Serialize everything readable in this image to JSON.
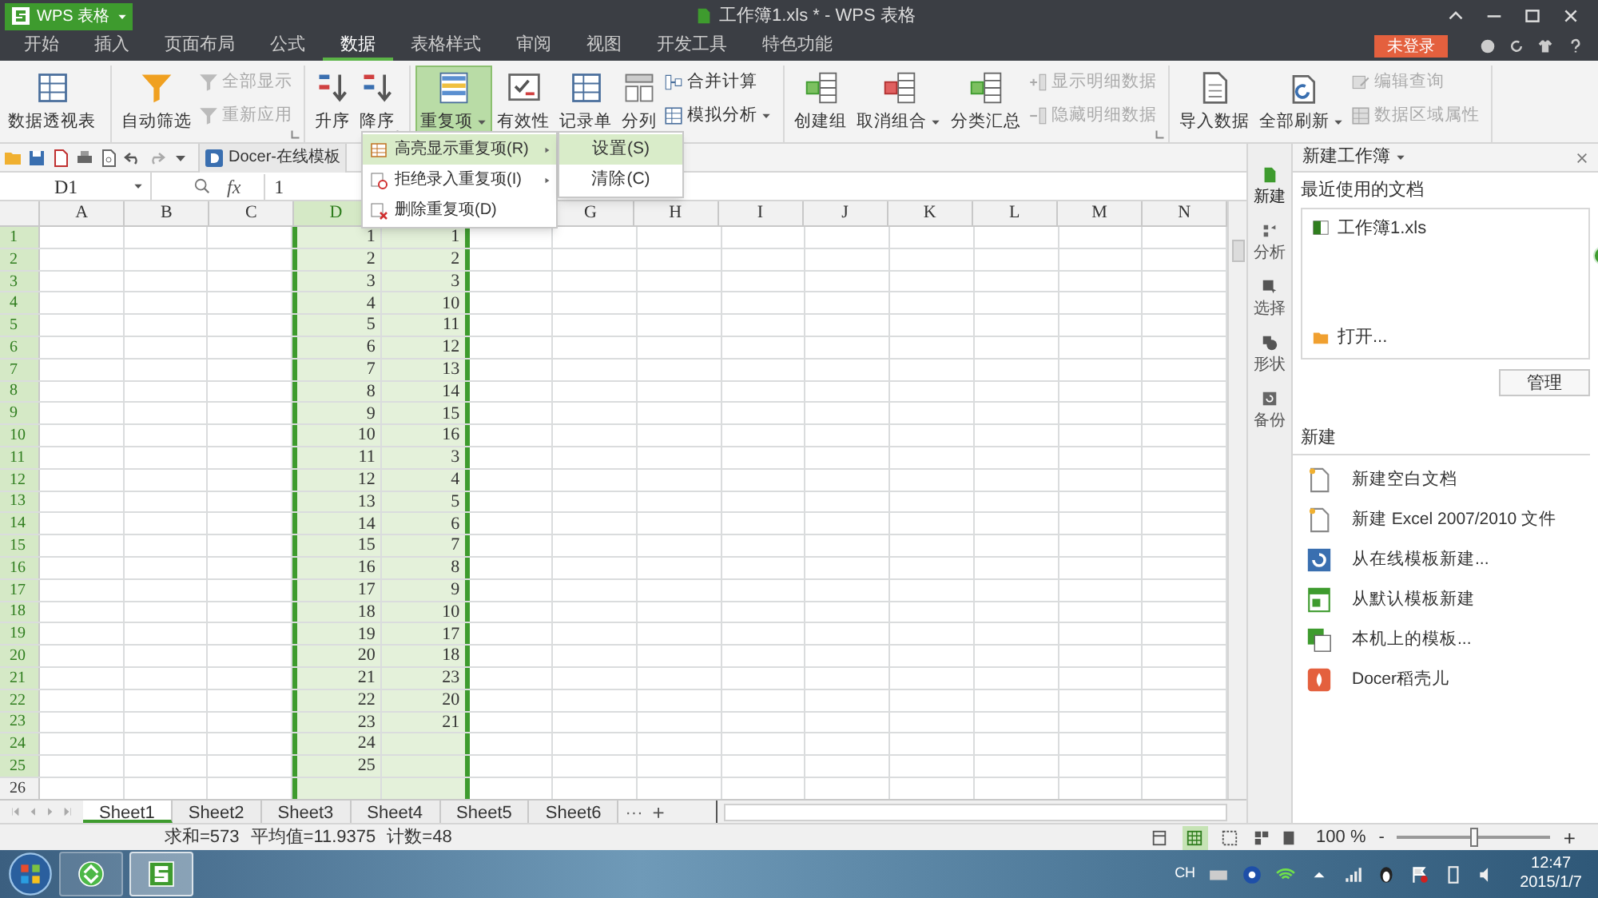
{
  "app_button": {
    "label": "WPS 表格"
  },
  "window": {
    "title": "工作簿1.xls * - WPS 表格"
  },
  "menu_tabs": [
    {
      "label": "开始",
      "selected": false
    },
    {
      "label": "插入",
      "selected": false
    },
    {
      "label": "页面布局",
      "selected": false
    },
    {
      "label": "公式",
      "selected": false
    },
    {
      "label": "数据",
      "selected": true
    },
    {
      "label": "表格样式",
      "selected": false
    },
    {
      "label": "审阅",
      "selected": false
    },
    {
      "label": "视图",
      "selected": false
    },
    {
      "label": "开发工具",
      "selected": false
    },
    {
      "label": "特色功能",
      "selected": false
    }
  ],
  "login_button": {
    "label": "未登录"
  },
  "ribbon_groups": [
    {
      "items": [
        {
          "kind": "large",
          "label": "数据透视表",
          "disabled": false,
          "pressed": false,
          "dropdown": false
        }
      ]
    },
    {
      "launcher": true,
      "items": [
        {
          "kind": "large",
          "label": "自动筛选",
          "disabled": false,
          "pressed": false,
          "dropdown": false
        },
        {
          "kind": "small",
          "label": "全部显示",
          "disabled": true,
          "pressed": false,
          "dropdown": false
        },
        {
          "kind": "small",
          "label": "重新应用",
          "disabled": true,
          "pressed": false,
          "dropdown": false
        }
      ]
    },
    {
      "launcher": true,
      "items": [
        {
          "kind": "large",
          "label": "升序",
          "disabled": false,
          "pressed": false,
          "dropdown": false
        },
        {
          "kind": "large",
          "label": "降序",
          "disabled": false,
          "pressed": false,
          "dropdown": false
        }
      ]
    },
    {
      "items": [
        {
          "kind": "large",
          "label": "重复项",
          "disabled": false,
          "pressed": true,
          "dropdown": true
        },
        {
          "kind": "large",
          "label": "有效性",
          "disabled": false,
          "pressed": false,
          "dropdown": false
        },
        {
          "kind": "large",
          "label": "记录单",
          "disabled": false,
          "pressed": false,
          "dropdown": false
        },
        {
          "kind": "large",
          "label": "分列",
          "disabled": false,
          "pressed": false,
          "dropdown": false
        },
        {
          "kind": "small",
          "label": "合并计算",
          "disabled": false,
          "pressed": false,
          "dropdown": false
        },
        {
          "kind": "small",
          "label": "模拟分析",
          "disabled": false,
          "pressed": false,
          "dropdown": true
        }
      ]
    },
    {
      "launcher": true,
      "items": [
        {
          "kind": "large",
          "label": "创建组",
          "disabled": false,
          "pressed": false,
          "dropdown": false
        },
        {
          "kind": "large",
          "label": "取消组合",
          "disabled": false,
          "pressed": false,
          "dropdown": true
        },
        {
          "kind": "large",
          "label": "分类汇总",
          "disabled": false,
          "pressed": false,
          "dropdown": false
        },
        {
          "kind": "small",
          "label": "显示明细数据",
          "disabled": true,
          "pressed": false,
          "dropdown": false
        },
        {
          "kind": "small",
          "label": "隐藏明细数据",
          "disabled": true,
          "pressed": false,
          "dropdown": false
        }
      ]
    },
    {
      "items": [
        {
          "kind": "large",
          "label": "导入数据",
          "disabled": false,
          "pressed": false,
          "dropdown": false
        },
        {
          "kind": "large",
          "label": "全部刷新",
          "disabled": false,
          "pressed": false,
          "dropdown": true
        },
        {
          "kind": "small",
          "label": "编辑查询",
          "disabled": true,
          "pressed": false,
          "dropdown": false
        },
        {
          "kind": "small",
          "label": "数据区域属性",
          "disabled": true,
          "pressed": false,
          "dropdown": false
        }
      ]
    }
  ],
  "docer_tab": {
    "label": "Docer-在线模板"
  },
  "formula_bar": {
    "name_box": "D1",
    "fx": "fx",
    "value": "1"
  },
  "grid": {
    "columns": [
      {
        "label": "A",
        "selected": false
      },
      {
        "label": "B",
        "selected": false
      },
      {
        "label": "C",
        "selected": false
      },
      {
        "label": "D",
        "selected": true,
        "cells": [
          "1",
          "2",
          "3",
          "4",
          "5",
          "6",
          "7",
          "8",
          "9",
          "10",
          "11",
          "12",
          "13",
          "14",
          "15",
          "16",
          "17",
          "18",
          "19",
          "20",
          "21",
          "22",
          "23",
          "24",
          "25"
        ]
      },
      {
        "selected": true,
        "cells": [
          "1",
          "2",
          "3",
          "10",
          "11",
          "12",
          "13",
          "14",
          "15",
          "16",
          "3",
          "4",
          "5",
          "6",
          "7",
          "8",
          "9",
          "10",
          "17",
          "18",
          "23",
          "20",
          "21"
        ]
      },
      {
        "selected": false
      },
      {
        "label": "G",
        "selected": false
      },
      {
        "label": "H",
        "selected": false
      },
      {
        "label": "I",
        "selected": false
      },
      {
        "label": "J",
        "selected": false
      },
      {
        "label": "K",
        "selected": false
      },
      {
        "label": "L",
        "selected": false
      },
      {
        "label": "M",
        "selected": false
      },
      {
        "label": "N",
        "selected": false
      }
    ],
    "rows": [
      {
        "label": "1",
        "selected": true
      },
      {
        "label": "2",
        "selected": true
      },
      {
        "label": "3",
        "selected": true
      },
      {
        "label": "4",
        "selected": true
      },
      {
        "label": "5",
        "selected": true
      },
      {
        "label": "6",
        "selected": true
      },
      {
        "label": "7",
        "selected": true
      },
      {
        "label": "8",
        "selected": true
      },
      {
        "label": "9",
        "selected": true
      },
      {
        "label": "10",
        "selected": true
      },
      {
        "label": "11",
        "selected": true
      },
      {
        "label": "12",
        "selected": true
      },
      {
        "label": "13",
        "selected": true
      },
      {
        "label": "14",
        "selected": true
      },
      {
        "label": "15",
        "selected": true
      },
      {
        "label": "16",
        "selected": true
      },
      {
        "label": "17",
        "selected": true
      },
      {
        "label": "18",
        "selected": true
      },
      {
        "label": "19",
        "selected": true
      },
      {
        "label": "20",
        "selected": true
      },
      {
        "label": "21",
        "selected": true
      },
      {
        "label": "22",
        "selected": true
      },
      {
        "label": "23",
        "selected": true
      },
      {
        "label": "24",
        "selected": true
      },
      {
        "label": "25",
        "selected": true
      },
      {
        "label": "26",
        "selected": false
      }
    ]
  },
  "dropdown_menu": {
    "items": [
      {
        "label": "高亮显示重复项(R)",
        "selected": true,
        "submenu": true
      },
      {
        "label": "拒绝录入重复项(I)",
        "selected": false,
        "submenu": true
      },
      {
        "label": "删除重复项(D)",
        "selected": false,
        "submenu": false
      }
    ],
    "submenu_items": [
      {
        "label": "设置(S)",
        "selected": true
      },
      {
        "label": "清除(C)",
        "selected": false
      }
    ]
  },
  "sheet_tabs": [
    {
      "label": "Sheet1",
      "selected": true
    },
    {
      "label": "Sheet2",
      "selected": false
    },
    {
      "label": "Sheet3",
      "selected": false
    },
    {
      "label": "Sheet4",
      "selected": false
    },
    {
      "label": "Sheet5",
      "selected": false
    },
    {
      "label": "Sheet6",
      "selected": false
    }
  ],
  "more_sheets": "···",
  "add_sheet": "+",
  "status_bar": {
    "summary": [
      "求和=573",
      "平均值=11.9375",
      "计数=48"
    ],
    "views": [
      {
        "selected": false
      },
      {
        "selected": true
      },
      {
        "selected": false
      }
    ],
    "zoom": "100 %",
    "zoom_out": "-",
    "zoom_in": "+",
    "zoom_slider": {
      "level": 0.5
    }
  },
  "side_tabs": [
    {
      "label": "新建",
      "selected": true
    },
    {
      "label": "分析",
      "selected": false
    },
    {
      "label": "选择",
      "selected": false
    },
    {
      "label": "形状",
      "selected": false
    },
    {
      "label": "备份",
      "selected": false
    }
  ],
  "task_pane": {
    "title": "新建工作簿",
    "recent_title": "最近使用的文档",
    "recent_files": [
      "工作簿1.xls"
    ],
    "open_label": "打开...",
    "manage_button": "管理",
    "new_title": "新建",
    "new_items": [
      "新建空白文档",
      "新建 Excel 2007/2010 文件",
      "从在线模板新建...",
      "从默认模板新建",
      "本机上的模板...",
      "Docer稻壳儿"
    ]
  },
  "taskbar": {
    "apps": [
      {
        "selected": false
      },
      {
        "selected": true
      }
    ],
    "input_method": "CH",
    "time": "12:47",
    "date": "2015/1/7"
  }
}
